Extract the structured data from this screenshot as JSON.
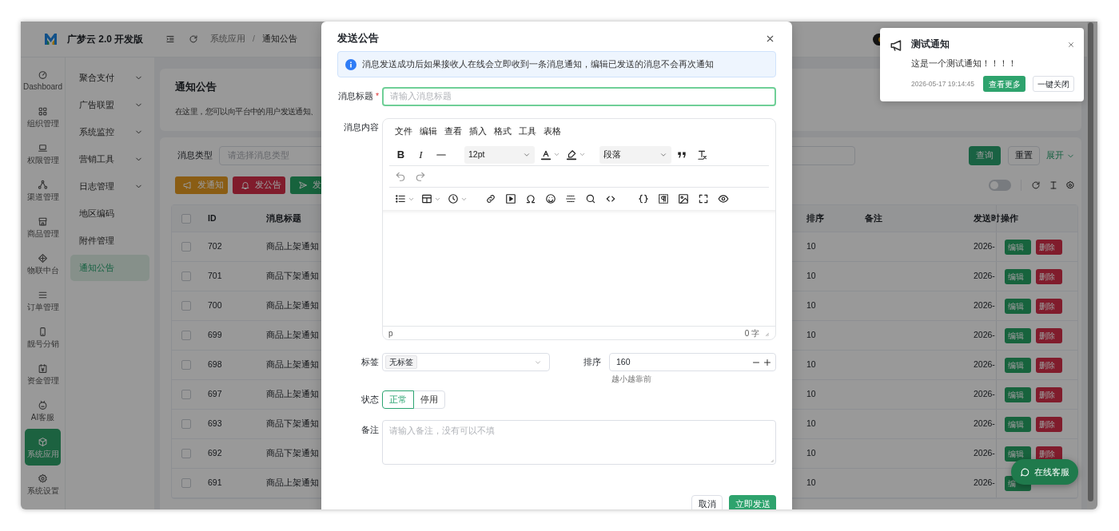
{
  "header": {
    "brand": "广梦云 2.0 开发版",
    "breadcrumb": [
      "系统应用",
      "通知公告"
    ],
    "breadcrumb_separator": "/"
  },
  "rail": [
    {
      "label": "Dashboard",
      "selected": false
    },
    {
      "label": "组织管理",
      "selected": false
    },
    {
      "label": "权限管理",
      "selected": false
    },
    {
      "label": "渠道管理",
      "selected": false
    },
    {
      "label": "商品管理",
      "selected": false
    },
    {
      "label": "物联中台",
      "selected": false
    },
    {
      "label": "订单管理",
      "selected": false
    },
    {
      "label": "靓号分销",
      "selected": false
    },
    {
      "label": "资金管理",
      "selected": false
    },
    {
      "label": "AI客服",
      "selected": false
    },
    {
      "label": "系统应用",
      "selected": true
    },
    {
      "label": "系统设置",
      "selected": false
    }
  ],
  "submenu": [
    {
      "label": "聚合支付",
      "expandable": true,
      "selected": false
    },
    {
      "label": "广告联盟",
      "expandable": true,
      "selected": false
    },
    {
      "label": "系统监控",
      "expandable": true,
      "selected": false
    },
    {
      "label": "营销工具",
      "expandable": true,
      "selected": false
    },
    {
      "label": "日志管理",
      "expandable": true,
      "selected": false
    },
    {
      "label": "地区编码",
      "expandable": false,
      "selected": false
    },
    {
      "label": "附件管理",
      "expandable": false,
      "selected": false
    },
    {
      "label": "通知公告",
      "expandable": false,
      "selected": true
    }
  ],
  "page": {
    "title": "通知公告",
    "description": "在这里，您可以向平台中的用户发送通知、"
  },
  "filter": {
    "label": "消息类型",
    "placeholder": "请选择消息类型",
    "search": "查询",
    "reset": "重置",
    "expand": "展开"
  },
  "actions": [
    {
      "kind": "notify",
      "label": "发通知"
    },
    {
      "kind": "announce",
      "label": "发公告"
    },
    {
      "kind": "send",
      "label": "发"
    }
  ],
  "table_toolbar": {
    "toggle_on": false
  },
  "table": {
    "header_checked": false,
    "columns": [
      "ID",
      "消息标题",
      "排序",
      "备注",
      "发送时",
      "操作"
    ],
    "rows": [
      {
        "checked": false,
        "id": "702",
        "title": "商品上架通知",
        "sort": "10",
        "time": "2026-",
        "actions": [
          "编辑",
          "删除"
        ]
      },
      {
        "checked": false,
        "id": "701",
        "title": "商品下架通知",
        "sort": "10",
        "time": "2026-",
        "actions": [
          "编辑",
          "删除"
        ]
      },
      {
        "checked": false,
        "id": "700",
        "title": "商品上架通知",
        "sort": "10",
        "time": "2026-",
        "actions": [
          "编辑",
          "删除"
        ]
      },
      {
        "checked": false,
        "id": "699",
        "title": "商品上架通知",
        "sort": "10",
        "time": "2026-",
        "actions": [
          "编辑",
          "删除"
        ]
      },
      {
        "checked": false,
        "id": "698",
        "title": "商品上架通知",
        "sort": "10",
        "time": "2026-",
        "actions": [
          "编辑",
          "删除"
        ]
      },
      {
        "checked": false,
        "id": "697",
        "title": "商品上架通知",
        "sort": "10",
        "time": "2026-",
        "actions": [
          "编辑",
          "删除"
        ]
      },
      {
        "checked": false,
        "id": "693",
        "title": "商品下架通知",
        "sort": "10",
        "time": "2026-",
        "actions": [
          "编辑",
          "删除"
        ]
      },
      {
        "checked": false,
        "id": "692",
        "title": "商品下架通知",
        "sort": "10",
        "time": "2026-",
        "actions": [
          "编辑",
          "删除"
        ]
      },
      {
        "checked": false,
        "id": "691",
        "title": "商品上架通知",
        "sort": "10",
        "time": "2026-",
        "actions": [
          "编"
        ]
      }
    ]
  },
  "dialog": {
    "title": "发送公告",
    "alert": "消息发送成功后如果接收人在线会立即收到一条消息通知，编辑已发送的消息不会再次通知",
    "title_field": {
      "label": "消息标题",
      "required_mark": "*",
      "placeholder": "请输入消息标题",
      "focused": true
    },
    "content": {
      "label": "消息内容",
      "menu": [
        "文件",
        "编辑",
        "查看",
        "插入",
        "格式",
        "工具",
        "表格"
      ],
      "bold": "B",
      "italic": "I",
      "font_size": "12pt",
      "block_format": "段落",
      "path": "p",
      "word_count": "0 字"
    },
    "tag": {
      "label": "标签",
      "chips": [
        "无标签"
      ]
    },
    "sort": {
      "label": "排序",
      "value": "160",
      "hint": "越小越靠前"
    },
    "status": {
      "label": "状态",
      "options": [
        {
          "label": "正常",
          "selected": true
        },
        {
          "label": "停用",
          "selected": false
        }
      ]
    },
    "remark": {
      "label": "备注",
      "placeholder": "请输入备注，没有可以不填"
    },
    "cancel": "取消",
    "submit": "立即发送"
  },
  "notification": {
    "title": "测试通知",
    "body": "这是一个测试通知！！！！",
    "time": "2026-05-17 19:14:45",
    "primary": "查看更多",
    "secondary": "一键关闭"
  },
  "chat": {
    "label": "在线客服"
  }
}
